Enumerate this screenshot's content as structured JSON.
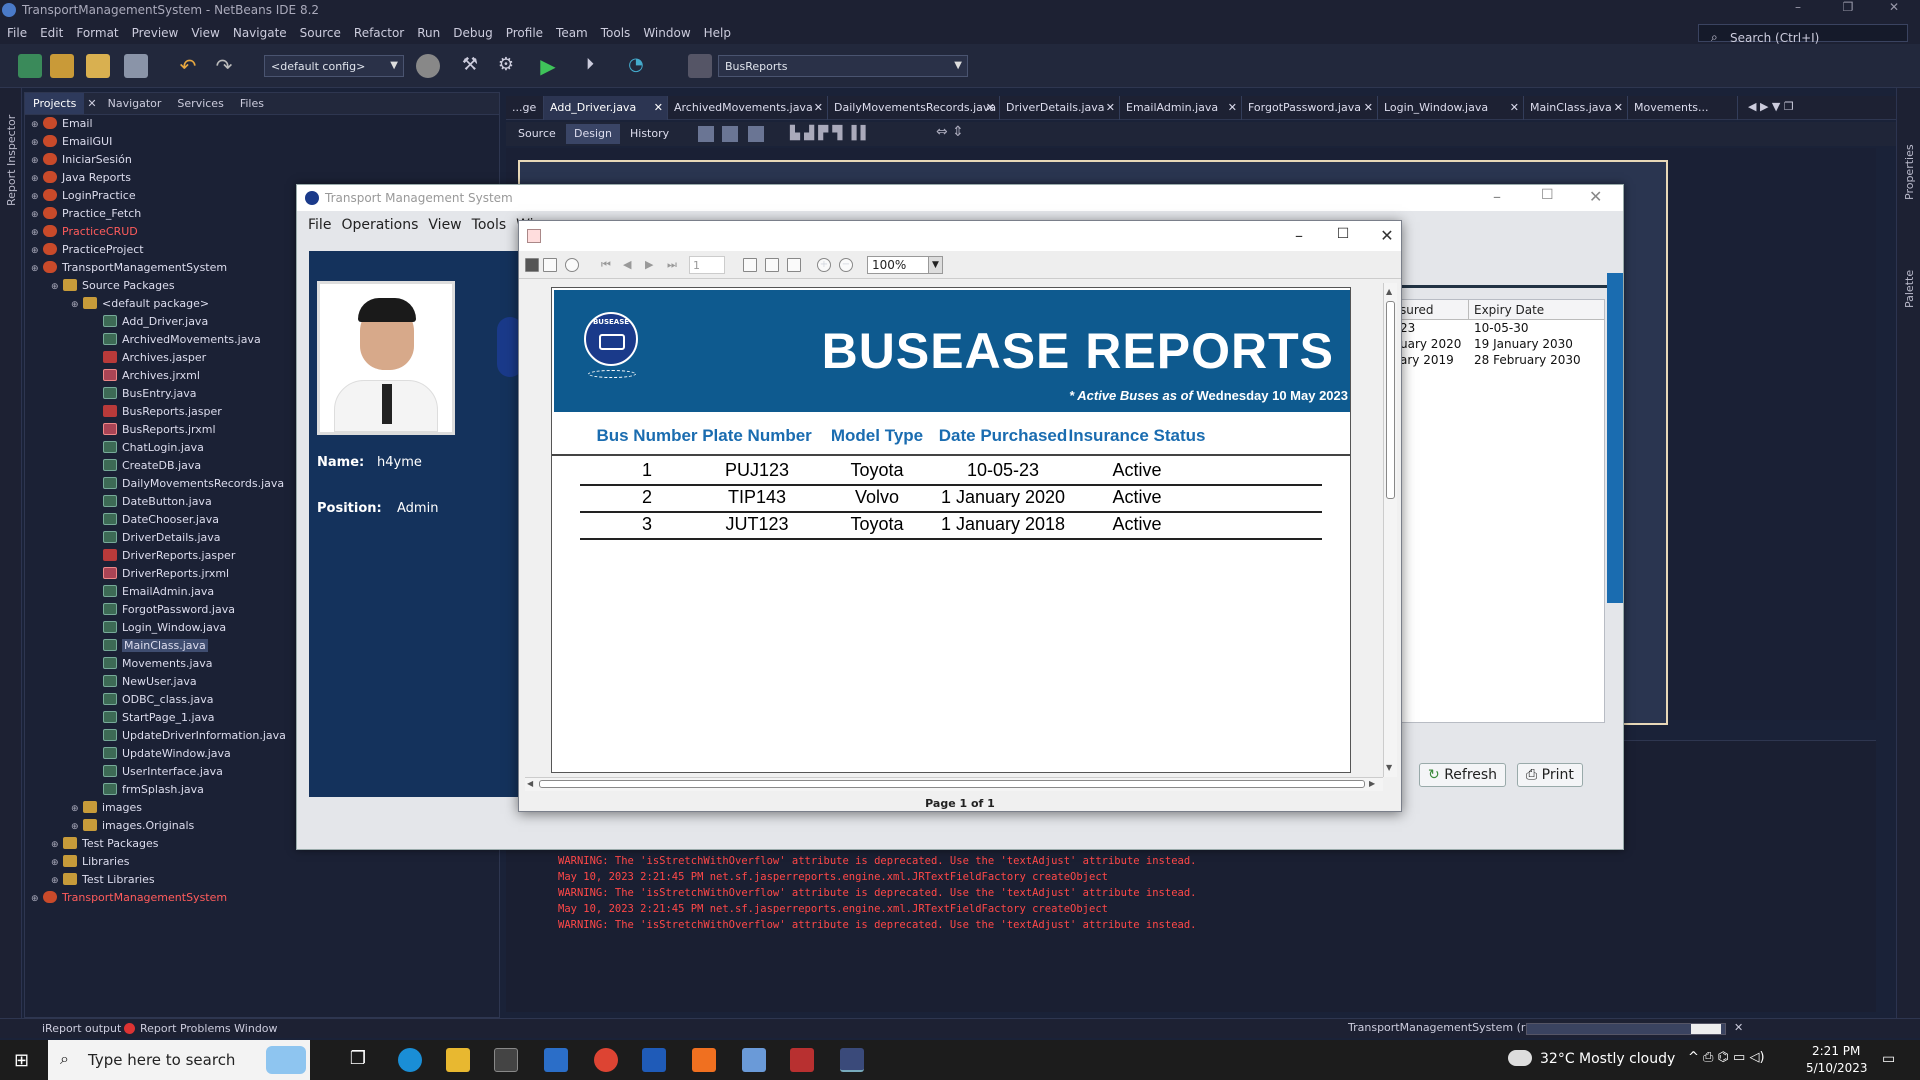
{
  "window": {
    "title": "TransportManagementSystem - NetBeans IDE 8.2"
  },
  "menu": [
    "File",
    "Edit",
    "Format",
    "Preview",
    "View",
    "Navigate",
    "Source",
    "Refactor",
    "Run",
    "Debug",
    "Profile",
    "Team",
    "Tools",
    "Window",
    "Help"
  ],
  "search": {
    "placeholder": "Search (Ctrl+I)"
  },
  "toolbar": {
    "config": "<default config>",
    "run_target": "BusReports"
  },
  "left_strip": {
    "label": "Report Inspector"
  },
  "right_strip": {
    "properties": "Properties",
    "palette": "Palette"
  },
  "panel_tabs": [
    "Projects",
    "Navigator",
    "Services",
    "Files"
  ],
  "tree": {
    "projects_top": [
      "Email",
      "EmailGUI",
      "IniciarSesión",
      "Java Reports",
      "LoginPractice",
      "Practice_Fetch",
      "PracticeCRUD",
      "PracticeProject",
      "TransportManagementSystem"
    ],
    "source_packages": "Source Packages",
    "default_package": "<default package>",
    "files": [
      "Add_Driver.java",
      "ArchivedMovements.java",
      "Archives.jasper",
      "Archives.jrxml",
      "BusEntry.java",
      "BusReports.jasper",
      "BusReports.jrxml",
      "ChatLogin.java",
      "CreateDB.java",
      "DailyMovementsRecords.java",
      "DateButton.java",
      "DateChooser.java",
      "DriverDetails.java",
      "DriverReports.jasper",
      "DriverReports.jrxml",
      "EmailAdmin.java",
      "ForgotPassword.java",
      "Login_Window.java",
      "MainClass.java",
      "Movements.java",
      "NewUser.java",
      "ODBC_class.java",
      "StartPage_1.java",
      "UpdateDriverInformation.java",
      "UpdateWindow.java",
      "UserInterface.java",
      "frmSplash.java"
    ],
    "others": [
      "images",
      "images.Originals"
    ],
    "project_nodes": [
      "Test Packages",
      "Libraries",
      "Test Libraries"
    ],
    "bottom_project": "TransportManagementSystem"
  },
  "editor_tabs": [
    "...ge",
    "Add_Driver.java",
    "ArchivedMovements.java",
    "DailyMovementsRecords.java",
    "DriverDetails.java",
    "EmailAdmin.java",
    "ForgotPassword.java",
    "Login_Window.java",
    "MainClass.java",
    "Movements..."
  ],
  "editor_modes": [
    "Source",
    "Design",
    "History"
  ],
  "output_lines": [
    "WARNING: The 'isStretchWithOverflow' attribute is deprecated. Use the 'textAdjust' attribute instead.",
    "May 10, 2023 2:21:45 PM net.sf.jasperreports.engine.xml.JRTextFieldFactory createObject",
    "WARNING: The 'isStretchWithOverflow' attribute is deprecated. Use the 'textAdjust' attribute instead.",
    "May 10, 2023 2:21:45 PM net.sf.jasperreports.engine.xml.JRTextFieldFactory createObject",
    "WARNING: The 'isStretchWithOverflow' attribute is deprecated. Use the 'textAdjust' attribute instead."
  ],
  "status": {
    "ireport": "iReport output",
    "problems": "Report Problems Window",
    "run": "TransportManagementSystem (run)"
  },
  "tms": {
    "title": "Transport Management System",
    "menu": [
      "File",
      "Operations",
      "View",
      "Tools",
      "Wi"
    ],
    "name_label": "Name:",
    "name_value": "h4yme",
    "position_label": "Position:",
    "position_value": "Admin",
    "table_headers": [
      "sured",
      "Expiry Date"
    ],
    "table_rows": [
      [
        "23",
        "10-05-30"
      ],
      [
        "uary 2020",
        "19 January 2030"
      ],
      [
        "ary 2019",
        "28 February 2030"
      ]
    ],
    "refresh": "Refresh",
    "print": "Print"
  },
  "viewer": {
    "zoom": "100%",
    "page_input": "1",
    "page_label": "Page 1 of 1",
    "report_title": "BUSEASE REPORTS",
    "subtitle_italic": "* Active Buses as of",
    "subtitle_date": "Wednesday 10 May 2023",
    "logo_text": "BUSEASE",
    "headers": [
      "Bus Number",
      "Plate Number",
      "Model Type",
      "Date Purchased",
      "Insurance Status"
    ],
    "rows": [
      [
        "1",
        "PUJ123",
        "Toyota",
        "10-05-23",
        "Active"
      ],
      [
        "2",
        "TIP143",
        "Volvo",
        "1 January 2020",
        "Active"
      ],
      [
        "3",
        "JUT123",
        "Toyota",
        "1 January 2018",
        "Active"
      ]
    ]
  },
  "taskbar": {
    "search": "Type here to search",
    "weather": "32°C  Mostly cloudy",
    "time": "2:21 PM",
    "date": "5/10/2023"
  }
}
